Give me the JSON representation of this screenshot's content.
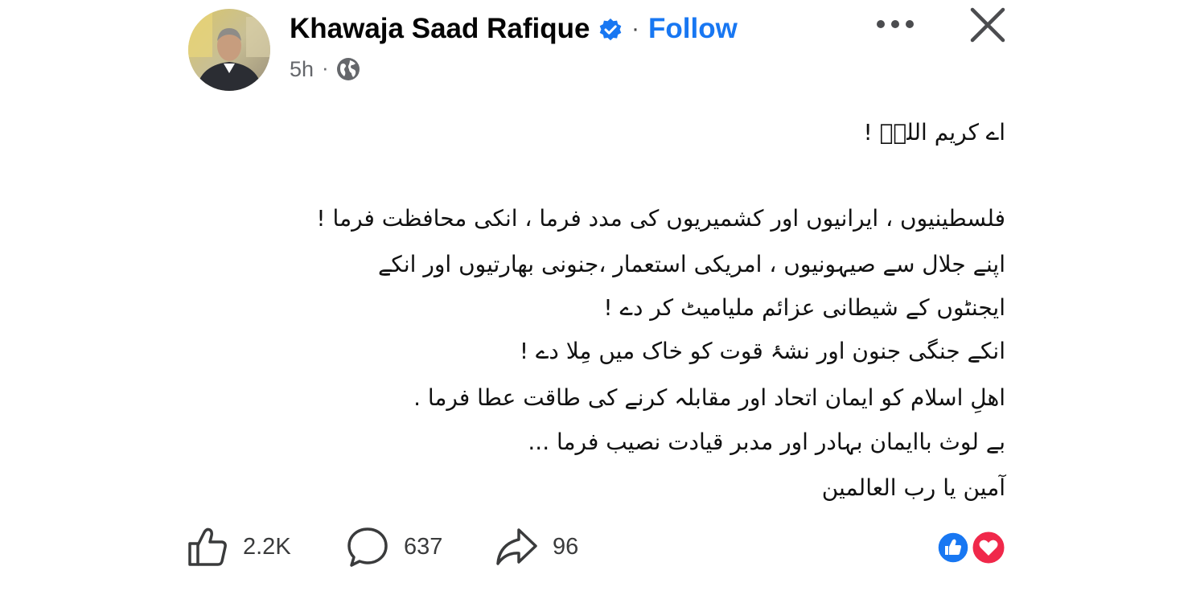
{
  "header": {
    "author_name": "Khawaja Saad Rafique",
    "separator": "·",
    "follow_label": "Follow",
    "time": "5h",
    "time_separator": "·",
    "audience_icon": "globe-icon",
    "more_icon": "more-dots-icon",
    "close_icon": "close-icon"
  },
  "post": {
    "lines": [
      "اے کریم اللہؐ !",
      "فلسطینیوں ، ایرانیوں اور کشمیریوں کی مدد  فرما ، انکی محافظت فرما !",
      "اپنے جلال سے صیہونیوں ، امریکی استعمار ،جنونی بھارتیوں اور انکے",
      "ایجنٹوں  کے شیطانی عزائم ملیامیٹ کر دے !",
      "انکے جنگی جنون اور نشۂ قوت کو خاک میں مِلا دے !",
      "اھلِ اسلام کو ایمان اتحاد اور مقابلہ کرنے کی طاقت عطا فرما .",
      "بے لوث باایمان بہادر اور مدبر قیادت نصیب فرما ...",
      "آمین  یا رب العالمین"
    ]
  },
  "footer": {
    "likes": "2.2K",
    "comments": "637",
    "shares": "96",
    "reactions": [
      "like",
      "love"
    ]
  },
  "colors": {
    "accent": "#1877f2",
    "love": "#f0284a",
    "text": "#050505",
    "muted": "#65676b"
  }
}
